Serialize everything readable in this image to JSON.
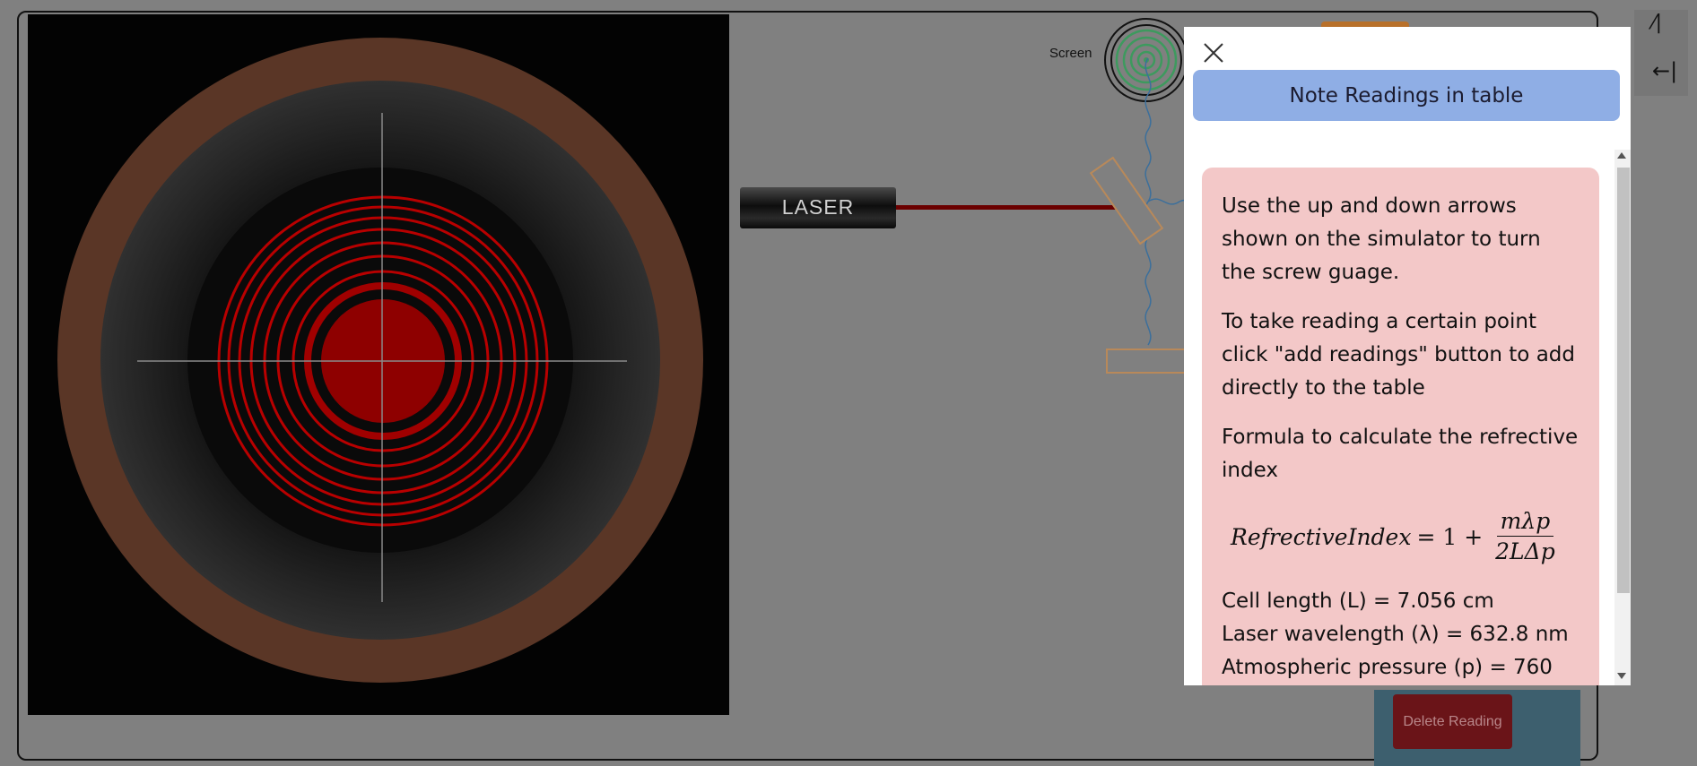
{
  "simulator": {
    "laser_label": "LASER",
    "screen_label": "Screen",
    "delete_reading_label": "Delete Reading",
    "viewer_fringe_color": "#b80000"
  },
  "corner": {
    "top_icon": "collapse-icon",
    "bottom_icon": "arrow-left-bar-icon",
    "bottom_glyph": "←|"
  },
  "modal": {
    "close_icon": "close-icon",
    "title": "Note Readings in table",
    "paragraphs": [
      "Use the up and down arrows shown on the simulator to turn the screw guage.",
      "To take reading a certain point click \"add readings\" button to add directly to the table",
      "Formula to calculate the refrective index"
    ],
    "formula": {
      "lhs": "RefrectiveIndex",
      "eq": "= 1 +",
      "numerator": "mλp",
      "denominator": "2LΔp"
    },
    "constants": [
      "Cell length (L) = 7.056 cm",
      "Laser wavelength (λ) = 632.8 nm",
      "Atmospheric pressure (p) = 760"
    ]
  }
}
